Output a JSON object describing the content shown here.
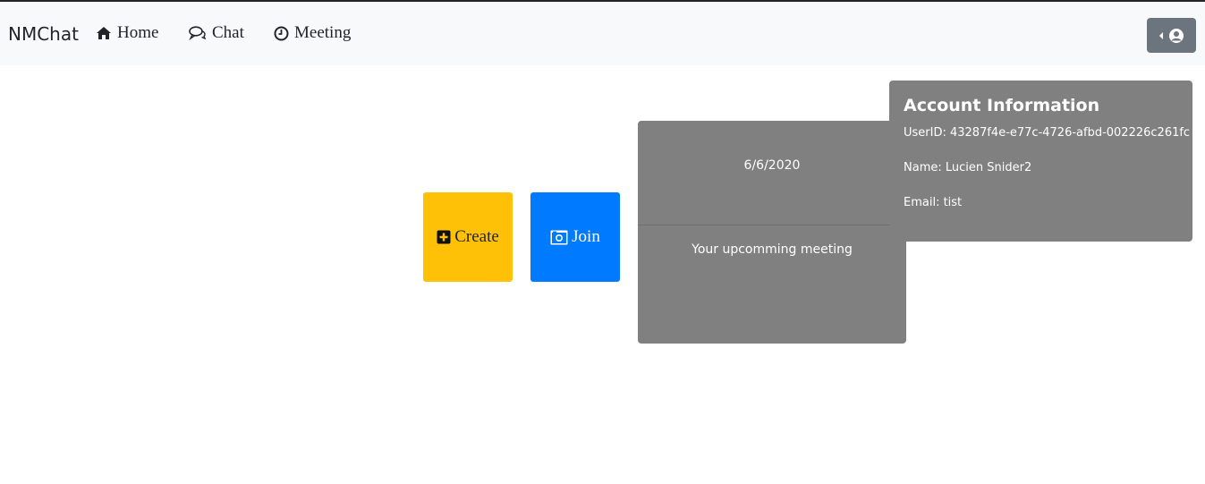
{
  "navbar": {
    "brand": "NMChat",
    "links": [
      {
        "label": "Home",
        "icon": "home-icon"
      },
      {
        "label": "Chat",
        "icon": "chat-icon"
      },
      {
        "label": "Meeting",
        "icon": "clock-icon"
      }
    ],
    "account_toggle": {
      "icons": [
        "caret-left-icon",
        "user-circle-icon"
      ]
    }
  },
  "actions": {
    "create": {
      "label": "Create",
      "icon": "plus-square-icon",
      "color": "#ffc107"
    },
    "join": {
      "label": "Join",
      "icon": "camera-icon",
      "color": "#007bff"
    }
  },
  "meeting_card": {
    "date": "6/6/2020",
    "text": "Your upcomming meeting"
  },
  "account_info": {
    "title": "Account Information",
    "userid": "UserID: 43287f4e-e77c-4726-afbd-002226c261fc",
    "name": "Name: Lucien Snider2",
    "email": "Email: tist"
  },
  "colors": {
    "navbar_bg": "#f8f9fa",
    "card_bg": "#808080",
    "toggle_bg": "#6c757d"
  }
}
